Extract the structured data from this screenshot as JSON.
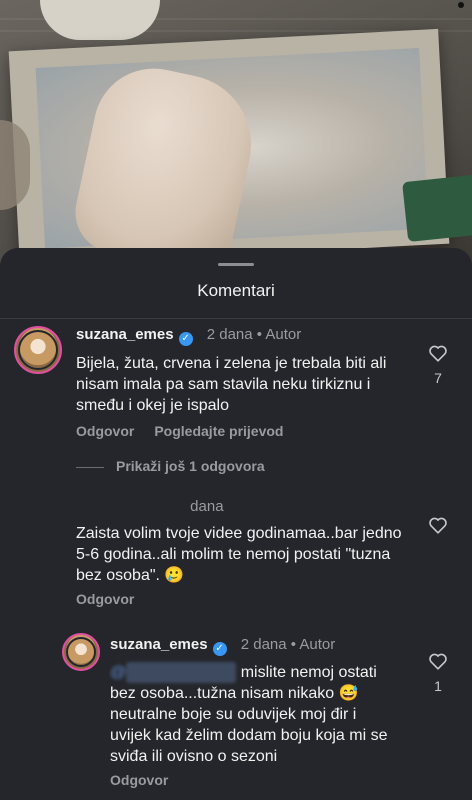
{
  "sheet": {
    "title": "Komentari"
  },
  "comments": [
    {
      "username": "suzana_emes",
      "time": "2 dana",
      "author_tag": "Autor",
      "text": "Bijela, žuta, crvena i zelena je trebala biti ali nisam imala pa sam stavila neku tirkiznu i smeđu i okej je ispalo",
      "reply_label": "Odgovor",
      "translate_label": "Pogledajte prijevod",
      "likes": "7",
      "more_replies": "Prikaži još 1 odgovora"
    },
    {
      "username": "",
      "time": "dana",
      "text": "Zaista volim tvoje videe godinamaa..bar jedno 5-6 godina..ali molim te nemoj postati \"tuzna bez osoba\". 🥲",
      "reply_label": "Odgovor"
    },
    {
      "username": "suzana_emes",
      "time": "2 dana",
      "author_tag": "Autor",
      "mention": "@",
      "text": "mislite nemoj ostati bez osoba...tužna nisam nikako 😅 neutralne boje su oduvijek moj đir i uvijek kad želim dodam boju koja mi se sviđa ili ovisno o sezoni",
      "reply_label": "Odgovor",
      "likes": "1"
    }
  ],
  "icons": {
    "like": "heart-icon",
    "verified": "verified-badge-icon"
  },
  "colors": {
    "sheet_bg": "#25262b",
    "verified": "#3897f0",
    "avatar_ring": "#e04fa0"
  }
}
